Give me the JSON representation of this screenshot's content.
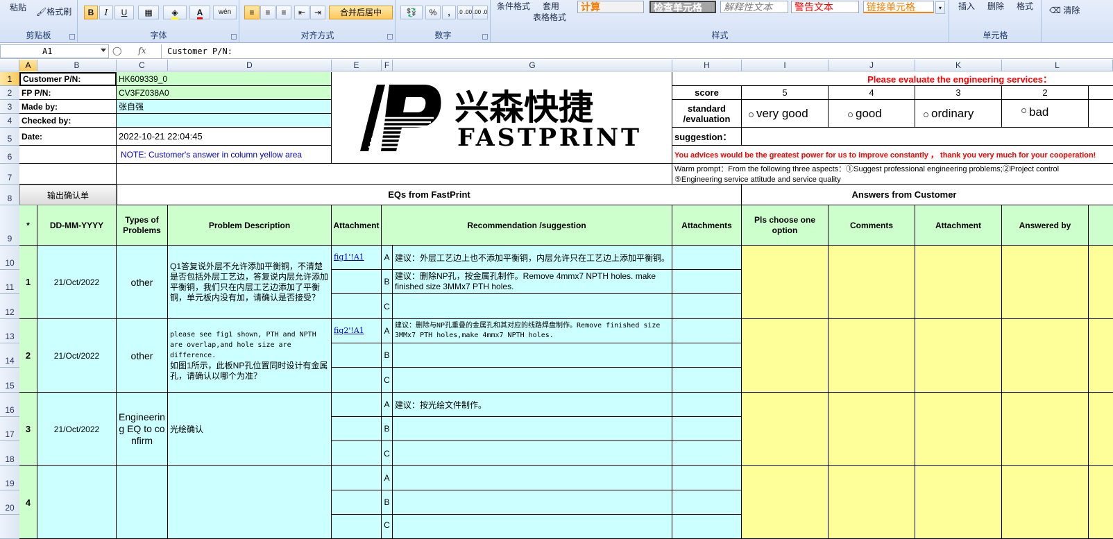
{
  "ribbon": {
    "paste": "粘贴",
    "format_painter": "格式刷",
    "clipboard_label": "剪贴板",
    "font_label": "字体",
    "align_label": "对齐方式",
    "number_label": "数字",
    "styles_label": "样式",
    "cells_label": "单元格",
    "bold": "B",
    "italic": "I",
    "underline": "U",
    "font_color": "A",
    "wen": "wén",
    "merge_center": "合并后居中",
    "percent": "%",
    "comma": ",",
    "inc_dec": ".0 .00",
    "dec_dec": ".00 .0",
    "cond_format": "条件格式",
    "table_format_1": "套用",
    "table_format_2": "表格格式",
    "style_calc": "计算",
    "style_check": "检查单元格",
    "style_explain": "解释性文本",
    "style_warn": "警告文本",
    "style_link": "链接单元格",
    "insert": "插入",
    "delete": "删除",
    "format": "格式",
    "clear": "清除",
    "colors": {
      "calc_fg": "#fa7d00",
      "check_bg": "#a5a5a5",
      "warn_fg": "#ff0000",
      "link_fg": "#fa7d00"
    }
  },
  "formula_bar": {
    "name_box": "A1",
    "fx": "fx",
    "content": "Customer P/N:"
  },
  "columns": [
    "A",
    "B",
    "C",
    "D",
    "E",
    "F",
    "G",
    "H",
    "I",
    "J",
    "K",
    "L"
  ],
  "rows": [
    "1",
    "2",
    "3",
    "4",
    "5",
    "6",
    "7",
    "8",
    "9",
    "10",
    "11",
    "12",
    "13",
    "14",
    "15",
    "16",
    "17",
    "18",
    "19",
    "20"
  ],
  "header": {
    "customer_pn_label": "Customer P/N:",
    "customer_pn": "HK609339_0",
    "fp_pn_label": "FP P/N:",
    "fp_pn": "CV3FZ038A0",
    "made_by_label": "Made by:",
    "made_by": "张自强",
    "checked_by_label": "Checked by:",
    "checked_by": "",
    "date_label": "Date:",
    "date": "2022-10-21 22:04:45",
    "note": "NOTE: Customer's  answer in column yellow area",
    "export_button": "输出确认单"
  },
  "logo": {
    "chinese": "兴森快捷",
    "english": "FASTPRINT"
  },
  "evaluation": {
    "title": "Please evaluate the engineering services：",
    "score_label": "score",
    "scores": [
      "5",
      "4",
      "3",
      "2"
    ],
    "standard_label": "standard /evaluation",
    "options": [
      "very good",
      "good",
      "ordinary",
      "bad"
    ],
    "suggestion_label": "suggestion：",
    "advice": "You advices would be the greatest power for us to improve constantly ，  thank you very much for your cooperation!",
    "warm_prompt_1": "Warm prompt：From the following three aspects：①Suggest professional engineering problems;②Project control",
    "warm_prompt_2": "⑤Engineering service attitude and service quality",
    "colors": {
      "title": "#ff0000",
      "advice": "#ff0000"
    }
  },
  "sections": {
    "eqs": "EQs from FastPrint",
    "answers": "Answers from Customer"
  },
  "table_headers": [
    "*",
    "DD-MM-YYYY",
    "Types of Problems",
    "Problem Description",
    "Attachment",
    "Recommendation /suggestion",
    "Attachments",
    "Pls choose one option",
    "Comments",
    "Attachment",
    "Answered by"
  ],
  "eqs": [
    {
      "no": "1",
      "date": "21/Oct/2022",
      "type": "other",
      "description": "Q1答复说外层不允许添加平衡铜，不清楚是否包括外层工艺边，答复说内层允许添加平衡铜，我们只在内层工艺边添加了平衡铜，单元板内没有加，请确认是否接受？",
      "attachment": "fig1'!A1",
      "options": [
        {
          "letter": "A",
          "text": "建议：外层工艺边上也不添加平衡铜，内层允许只在工艺边上添加平衡铜。"
        },
        {
          "letter": "B",
          "text": "建议：删除NP孔，按金属孔制作。Remove 4mmx7 NPTH holes. make finished size 3MMx7 PTH holes."
        },
        {
          "letter": "C",
          "text": ""
        }
      ]
    },
    {
      "no": "2",
      "date": "21/Oct/2022",
      "type": "other",
      "description_en": "please see fig1 shown, PTH and NPTH are overlap,and hole size are difference.",
      "description": "如图1所示，此板NP孔位置同时设计有金属孔，请确认以哪个为准？",
      "attachment": "fig2'!A1",
      "options": [
        {
          "letter": "A",
          "text": "建议：删除与NP孔重叠的金属孔和其对应的线路焊盘制作。Remove finished size 3MMx7 PTH holes,make 4mmx7 NPTH holes."
        },
        {
          "letter": "B",
          "text": ""
        },
        {
          "letter": "C",
          "text": ""
        }
      ]
    },
    {
      "no": "3",
      "date": "21/Oct/2022",
      "type": "Engineering EQ to confirm",
      "description": "光绘确认",
      "attachment": "",
      "options": [
        {
          "letter": "A",
          "text": "建议：按光绘文件制作。"
        },
        {
          "letter": "B",
          "text": ""
        },
        {
          "letter": "C",
          "text": ""
        }
      ]
    },
    {
      "no": "4",
      "date": "",
      "type": "",
      "description": "",
      "attachment": "",
      "options": [
        {
          "letter": "A",
          "text": ""
        },
        {
          "letter": "B",
          "text": ""
        },
        {
          "letter": "C",
          "text": ""
        }
      ]
    }
  ]
}
